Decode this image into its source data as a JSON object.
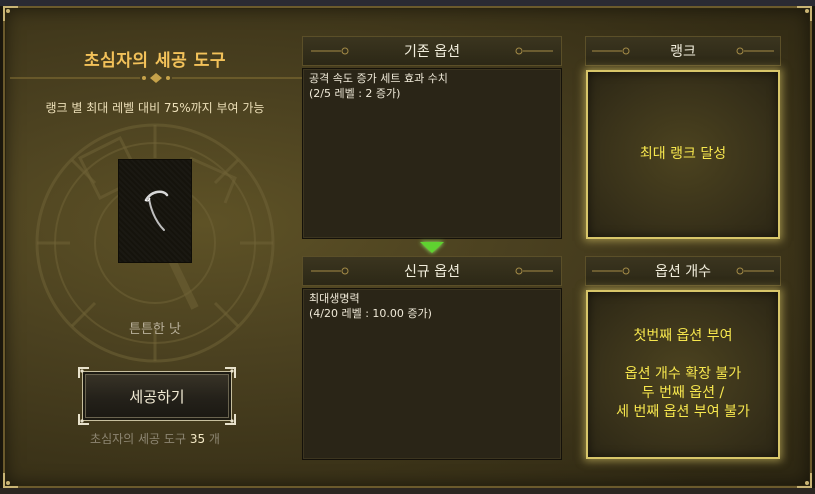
{
  "left": {
    "title": "초심자의 세공 도구",
    "description": "랭크 별 최대 레벨 대비 75%까지 부여 가능",
    "item_name": "튼튼한 낫",
    "craft_button": "세공하기",
    "count_prefix": "초심자의 세공 도구",
    "count_value": "35",
    "count_suffix": "개",
    "item_icon": "scythe-icon"
  },
  "existing_option": {
    "header": "기존 옵션",
    "lines": [
      "공격 속도 증가 세트 효과 수치",
      "(2/5 레벨 : 2 증가)"
    ]
  },
  "new_option": {
    "header": "신규 옵션",
    "lines": [
      "최대생명력",
      "(4/20 레벨 : 10.00 증가)"
    ]
  },
  "rank": {
    "header": "랭크",
    "text": "최대 랭크 달성"
  },
  "option_count": {
    "header": "옵션 개수",
    "line1": "첫번째 옵션 부여",
    "line2": "옵션 개수 확장 불가",
    "line3": "두 번째 옵션 /",
    "line4": "세 번째 옵션 부여 불가"
  },
  "colors": {
    "title_gold": "#f3c25a",
    "highlight_yellow": "#f7e74e",
    "arrow_green": "#5fd230",
    "panel_border_glow": "#d8c66a"
  }
}
